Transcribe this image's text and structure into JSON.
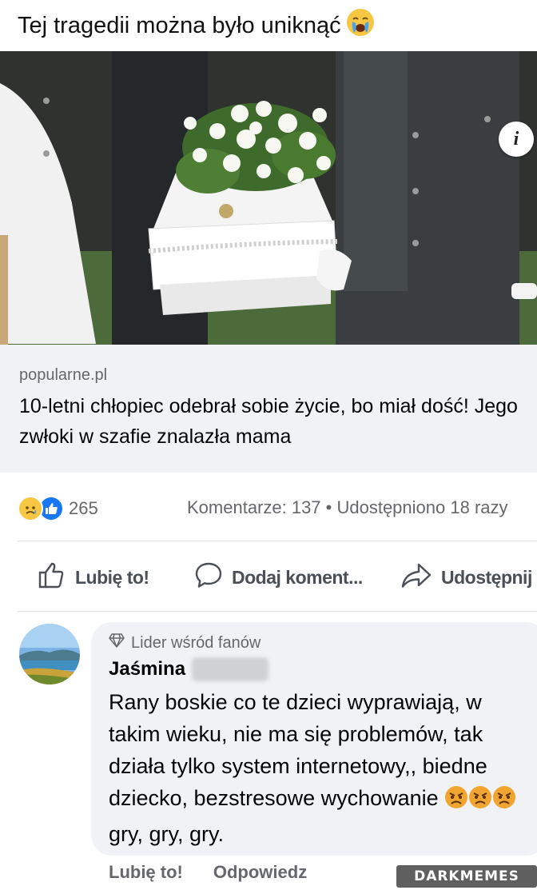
{
  "post": {
    "caption": "Tej tragedii można było uniknąć"
  },
  "link_preview": {
    "domain": "popularne.pl",
    "title": "10-letni chłopiec odebrał sobie życie, bo miał dość! Jego zwłoki w szafie znalazła mama"
  },
  "stats": {
    "reaction_count": "265",
    "comments_shares": "Komentarze: 137 • Udostępniono 18 razy"
  },
  "actions": {
    "like": "Lubię to!",
    "comment": "Dodaj koment...",
    "share": "Udostępnij"
  },
  "comment": {
    "badge": "Lider wśród fanów",
    "author": "Jaśmina",
    "text": "Rany boskie co te dzieci wyprawiają, w takim wieku, nie ma się problemów, tak działa tylko system internetowy,, biedne dziecko, bezstresowe wychowanie",
    "text_after_emoji": "gry, gry, gry.",
    "like_label": "Lubię to!",
    "reply_label": "Odpowiedz"
  },
  "watermark": "DARKMEMES",
  "icons": {
    "caption_emoji": "crying-face-icon",
    "info": "info-icon",
    "reaction_sad": "sad-reaction-icon",
    "reaction_like": "like-reaction-icon",
    "like": "thumbs-up-icon",
    "comment": "speech-bubble-icon",
    "share": "share-arrow-icon",
    "badge": "diamond-icon",
    "comment_emoji": "angry-face-icon"
  },
  "colors": {
    "facebook_blue": "#1877f2",
    "preview_bg": "#f0f2f5",
    "secondary_text": "#65676b"
  }
}
